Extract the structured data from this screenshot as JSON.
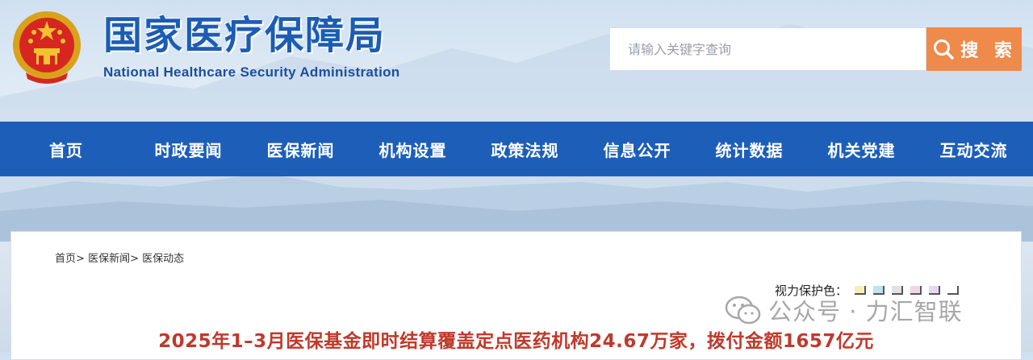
{
  "header": {
    "title_cn": "国家医疗保障局",
    "title_en": "National Healthcare Security Administration"
  },
  "search": {
    "placeholder": "请输入关键字查询",
    "button_label": "搜 索"
  },
  "nav": {
    "items": [
      "首页",
      "时政要闻",
      "医保新闻",
      "机构设置",
      "政策法规",
      "信息公开",
      "统计数据",
      "机关党建",
      "互动交流"
    ]
  },
  "breadcrumb": {
    "items": [
      "首页",
      "医保新闻",
      "医保动态"
    ],
    "separator": ">"
  },
  "eye_care": {
    "label": "视力保护色：",
    "swatches": [
      "#f6f0b5",
      "#bfe3f0",
      "#e2e2e2",
      "#f3d6e6",
      "#e4d8f2",
      "#ffffff"
    ]
  },
  "watermark": {
    "text": "公众号 · 力汇智联",
    "icon": "wechat-icon"
  },
  "article": {
    "title": "2025年1–3月医保基金即时结算覆盖定点医药机构24.67万家，拨付金额1657亿元"
  },
  "colors": {
    "brand_blue": "#1d5fb8",
    "search_orange": "#ee8a4a",
    "title_red": "#c0392b"
  }
}
